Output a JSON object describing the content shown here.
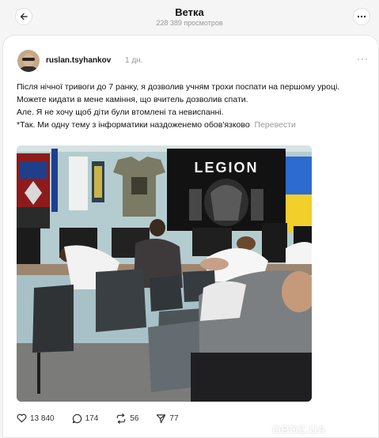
{
  "header": {
    "title": "Ветка",
    "subtitle": "228 389 просмотров"
  },
  "post": {
    "username": "ruslan.tsyhankov",
    "time": "1 дн.",
    "lines": [
      "Після нічної тривоги до 7 ранку, я дозволив учням трохи поспати на першому уроці.",
      "Можете кидати в мене каміння, що вчитель дозволив спати.",
      "Але. Я не хочу щоб діти були втомлені та невиспанні.",
      "*Так. Ми одну тему з інформатики наздоженемо обов'язково"
    ],
    "translate_label": "Перевести",
    "photo_text": "LEGION"
  },
  "actions": {
    "likes": "13 840",
    "comments": "174",
    "reposts": "56",
    "shares": "77"
  },
  "watermark": "OBOZ.UA",
  "icons": [
    "back-arrow-icon",
    "more-icon",
    "heart-icon",
    "comment-icon",
    "repost-icon",
    "share-icon"
  ]
}
